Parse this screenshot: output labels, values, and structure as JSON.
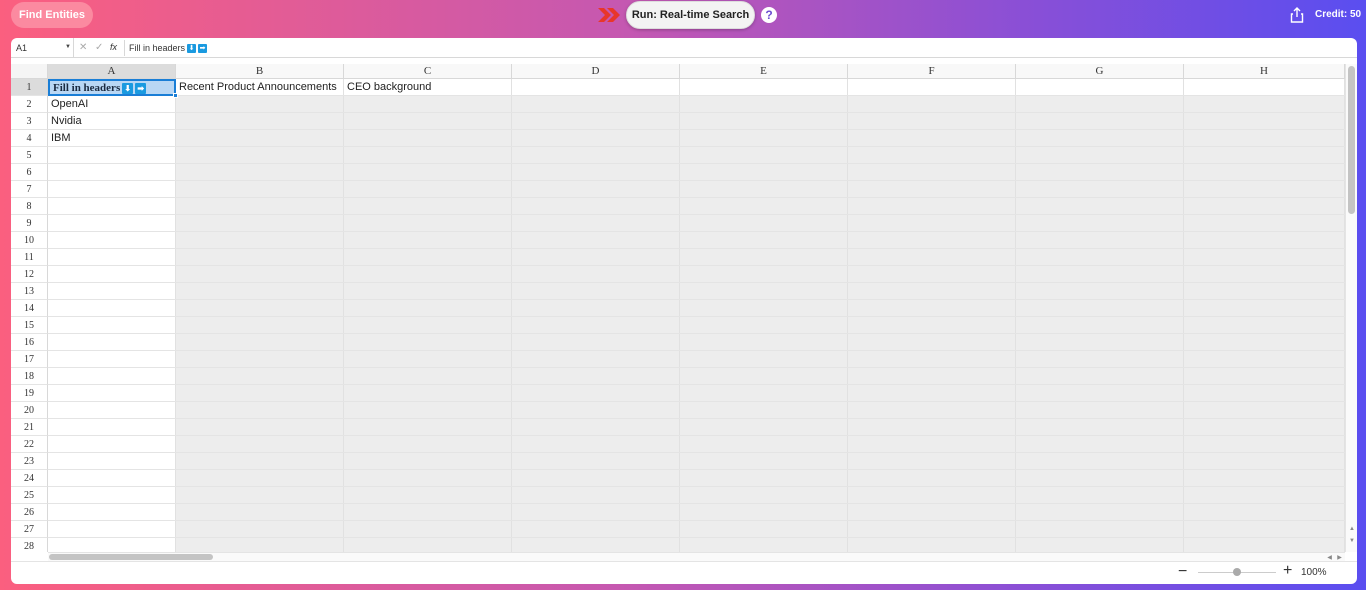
{
  "topbar": {
    "find_entities_label": "Find Entities",
    "run_label": "Run: Real-time Search",
    "help_glyph": "?",
    "credit_label": "Credit: 50"
  },
  "formula_bar": {
    "cell_ref": "A1",
    "cancel_glyph": "✕",
    "confirm_glyph": "✓",
    "fx_label": "fx",
    "content": "Fill in headers"
  },
  "grid": {
    "columns": [
      "A",
      "B",
      "C",
      "D",
      "E",
      "F",
      "G",
      "H"
    ],
    "rows": [
      "1",
      "2",
      "3",
      "4",
      "5",
      "6",
      "7",
      "8",
      "9",
      "10",
      "11",
      "12",
      "13",
      "14",
      "15",
      "16",
      "17",
      "18",
      "19",
      "20",
      "21",
      "22",
      "23",
      "24",
      "25",
      "26",
      "27",
      "28"
    ],
    "selected_cell": "A1",
    "cells": {
      "A1": "Fill in headers",
      "B1": "Recent Product Announcements",
      "C1": "CEO background",
      "A2": "OpenAI",
      "A3": "Nvidia",
      "A4": "IBM"
    },
    "badge_down": "⬇",
    "badge_right": "➡"
  },
  "footer": {
    "zoom_minus": "−",
    "zoom_plus": "+",
    "zoom_value": "100%"
  },
  "icons": {
    "arrow": "double-chevron-right-icon",
    "help": "question-icon",
    "share": "share-icon"
  },
  "colors": {
    "accent": "#1a7ed6",
    "badge": "#1a9ae0",
    "arrow": "#e8362a"
  }
}
